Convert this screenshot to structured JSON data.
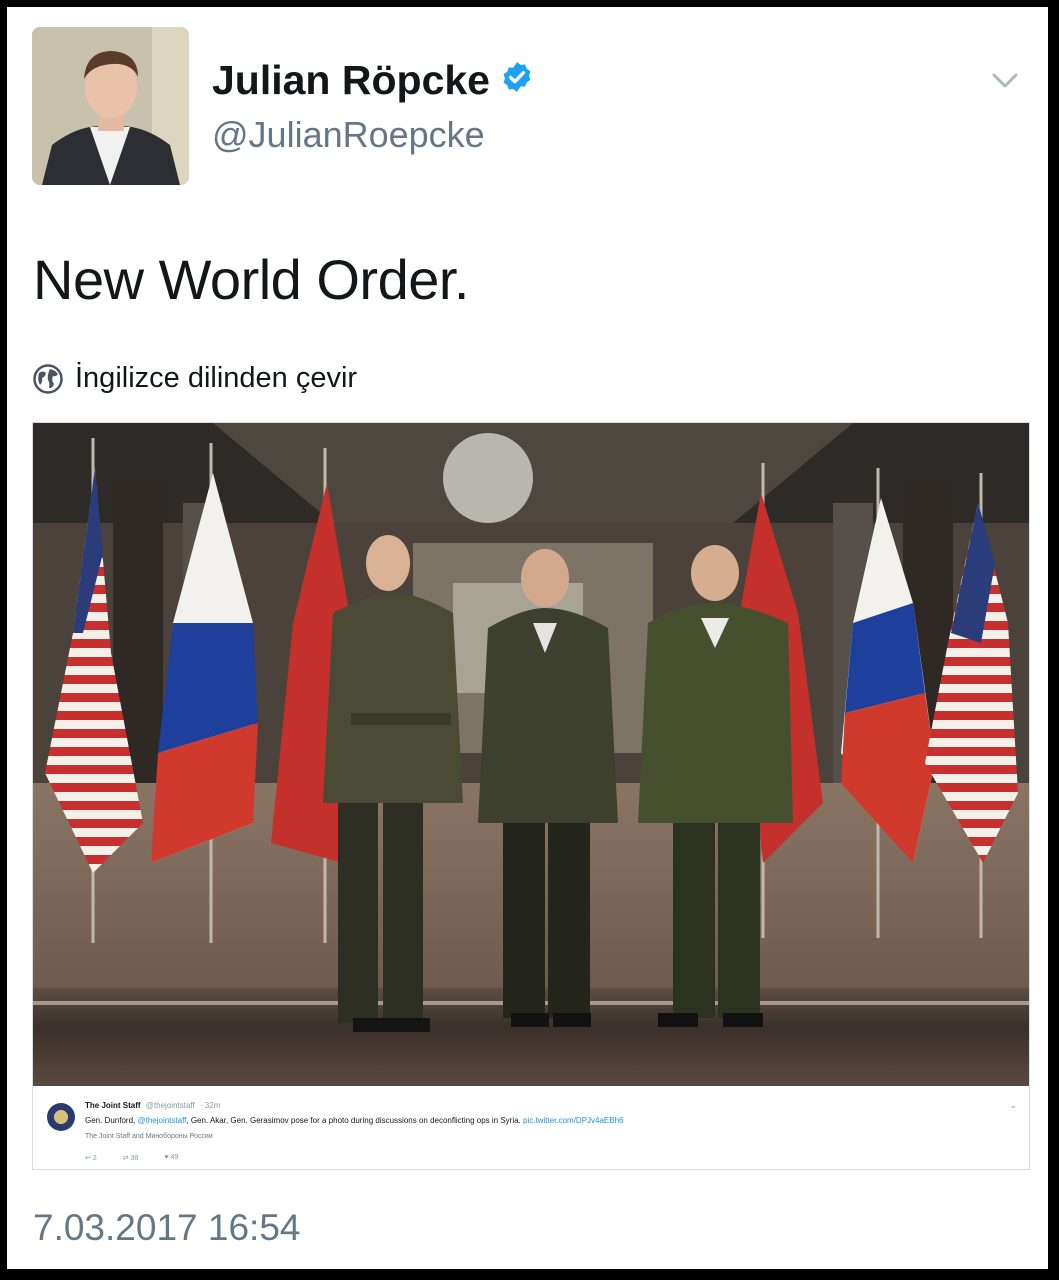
{
  "tweet": {
    "author_name": "Julian Röpcke",
    "author_handle": "@JulianRoepcke",
    "text": "New World Order.",
    "translate_label": "İngilizce dilinden çevir",
    "timestamp": "7.03.2017 16:54",
    "verified_color": "#1da1f2"
  },
  "embedded_tweet": {
    "author_name": "The Joint Staff",
    "author_handle": "@thejointstaff",
    "age": "· 32m",
    "text_before": "Gen. Dunford,",
    "mention": "@thejointstaff",
    "text_after": ", Gen. Akar, Gen. Gerasimov pose for a photo during discussions on deconflicting ops in Syria.",
    "link": "pic.twitter.com/DPJv4aEBh6",
    "photo_credit": "The Joint Staff and Минобороны России",
    "replies": "2",
    "retweets": "38",
    "likes": "49"
  },
  "icons": {
    "verified": "verified-badge-icon",
    "menu": "chevron-down-icon",
    "translate": "globe-icon"
  }
}
